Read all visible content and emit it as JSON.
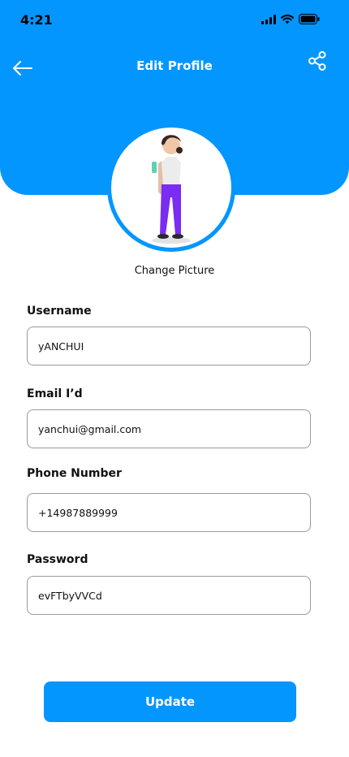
{
  "status_bar": {
    "time": "4:21"
  },
  "header": {
    "title": "Edit Profile",
    "back_icon": "arrow-left-icon",
    "share_icon": "share-icon"
  },
  "avatar": {
    "change_label": "Change Picture"
  },
  "fields": {
    "username": {
      "label": "Username",
      "value": "yANCHUI"
    },
    "email": {
      "label": "Email I’d",
      "value": "yanchui@gmail.com"
    },
    "phone": {
      "label": "Phone Number",
      "value": "+14987889999"
    },
    "password": {
      "label": "Password",
      "value": "evFTbyVVCd"
    }
  },
  "actions": {
    "update_label": "Update"
  },
  "colors": {
    "primary": "#0496FF",
    "background": "#FFFFFF",
    "text": "#111111"
  }
}
